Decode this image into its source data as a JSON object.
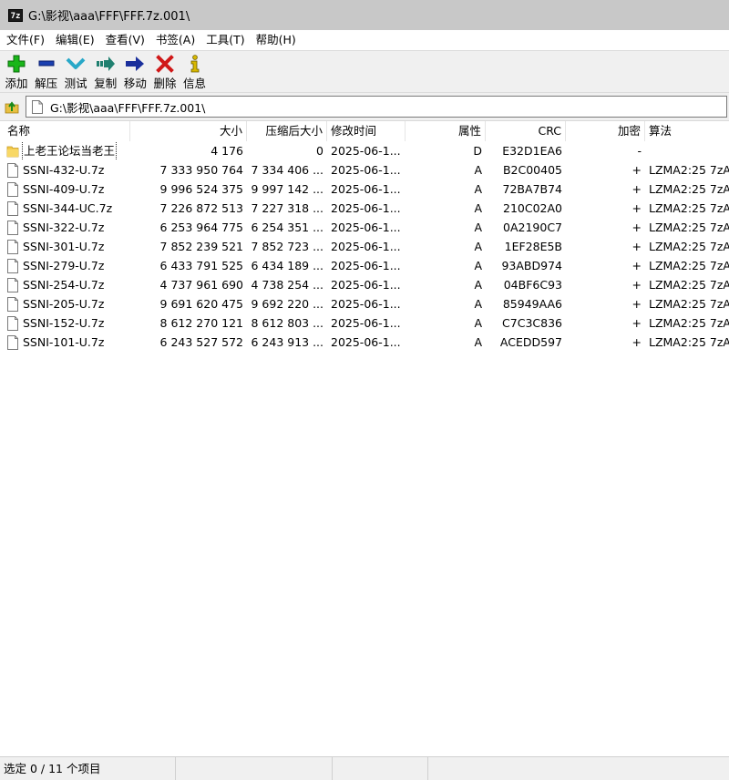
{
  "window": {
    "title": "G:\\影视\\aaa\\FFF\\FFF.7z.001\\",
    "icon_text": "7z"
  },
  "menu": [
    "文件(F)",
    "编辑(E)",
    "查看(V)",
    "书签(A)",
    "工具(T)",
    "帮助(H)"
  ],
  "toolbar": [
    {
      "label": "添加",
      "icon": "plus-icon",
      "color": "#19b619"
    },
    {
      "label": "解压",
      "icon": "minus-icon",
      "color": "#1a3fb0"
    },
    {
      "label": "测试",
      "icon": "check-icon",
      "color": "#28a8c8"
    },
    {
      "label": "复制",
      "icon": "copy-arrow-icon",
      "color": "#208070"
    },
    {
      "label": "移动",
      "icon": "move-arrow-icon",
      "color": "#1a2f9c"
    },
    {
      "label": "删除",
      "icon": "delete-x-icon",
      "color": "#d01818"
    },
    {
      "label": "信息",
      "icon": "info-icon",
      "color": "#d8b800"
    }
  ],
  "address": {
    "path": "G:\\影视\\aaa\\FFF\\FFF.7z.001\\"
  },
  "columns": [
    "名称",
    "大小",
    "压缩后大小",
    "修改时间",
    "属性",
    "CRC",
    "加密",
    "算法"
  ],
  "rows": [
    {
      "type": "folder",
      "name": "上老王论坛当老王",
      "size": "4 176",
      "packed": "0",
      "modified": "2025-06-1...",
      "attr": "D",
      "crc": "E32D1EA6",
      "encrypted": "-",
      "method": ""
    },
    {
      "type": "file",
      "name": "SSNI-432-U.7z",
      "size": "7 333 950 764",
      "packed": "7 334 406 ...",
      "modified": "2025-06-1...",
      "attr": "A",
      "crc": "B2C00405",
      "encrypted": "+",
      "method": "LZMA2:25 7zA"
    },
    {
      "type": "file",
      "name": "SSNI-409-U.7z",
      "size": "9 996 524 375",
      "packed": "9 997 142 ...",
      "modified": "2025-06-1...",
      "attr": "A",
      "crc": "72BA7B74",
      "encrypted": "+",
      "method": "LZMA2:25 7zA"
    },
    {
      "type": "file",
      "name": "SSNI-344-UC.7z",
      "size": "7 226 872 513",
      "packed": "7 227 318 ...",
      "modified": "2025-06-1...",
      "attr": "A",
      "crc": "210C02A0",
      "encrypted": "+",
      "method": "LZMA2:25 7zA"
    },
    {
      "type": "file",
      "name": "SSNI-322-U.7z",
      "size": "6 253 964 775",
      "packed": "6 254 351 ...",
      "modified": "2025-06-1...",
      "attr": "A",
      "crc": "0A2190C7",
      "encrypted": "+",
      "method": "LZMA2:25 7zA"
    },
    {
      "type": "file",
      "name": "SSNI-301-U.7z",
      "size": "7 852 239 521",
      "packed": "7 852 723 ...",
      "modified": "2025-06-1...",
      "attr": "A",
      "crc": "1EF28E5B",
      "encrypted": "+",
      "method": "LZMA2:25 7zA"
    },
    {
      "type": "file",
      "name": "SSNI-279-U.7z",
      "size": "6 433 791 525",
      "packed": "6 434 189 ...",
      "modified": "2025-06-1...",
      "attr": "A",
      "crc": "93ABD974",
      "encrypted": "+",
      "method": "LZMA2:25 7zA"
    },
    {
      "type": "file",
      "name": "SSNI-254-U.7z",
      "size": "4 737 961 690",
      "packed": "4 738 254 ...",
      "modified": "2025-06-1...",
      "attr": "A",
      "crc": "04BF6C93",
      "encrypted": "+",
      "method": "LZMA2:25 7zA"
    },
    {
      "type": "file",
      "name": "SSNI-205-U.7z",
      "size": "9 691 620 475",
      "packed": "9 692 220 ...",
      "modified": "2025-06-1...",
      "attr": "A",
      "crc": "85949AA6",
      "encrypted": "+",
      "method": "LZMA2:25 7zA"
    },
    {
      "type": "file",
      "name": "SSNI-152-U.7z",
      "size": "8 612 270 121",
      "packed": "8 612 803 ...",
      "modified": "2025-06-1...",
      "attr": "A",
      "crc": "C7C3C836",
      "encrypted": "+",
      "method": "LZMA2:25 7zA"
    },
    {
      "type": "file",
      "name": "SSNI-101-U.7z",
      "size": "6 243 527 572",
      "packed": "6 243 913 ...",
      "modified": "2025-06-1...",
      "attr": "A",
      "crc": "ACEDD597",
      "encrypted": "+",
      "method": "LZMA2:25 7zA"
    }
  ],
  "status": {
    "selection": "选定 0 / 11 个项目"
  }
}
